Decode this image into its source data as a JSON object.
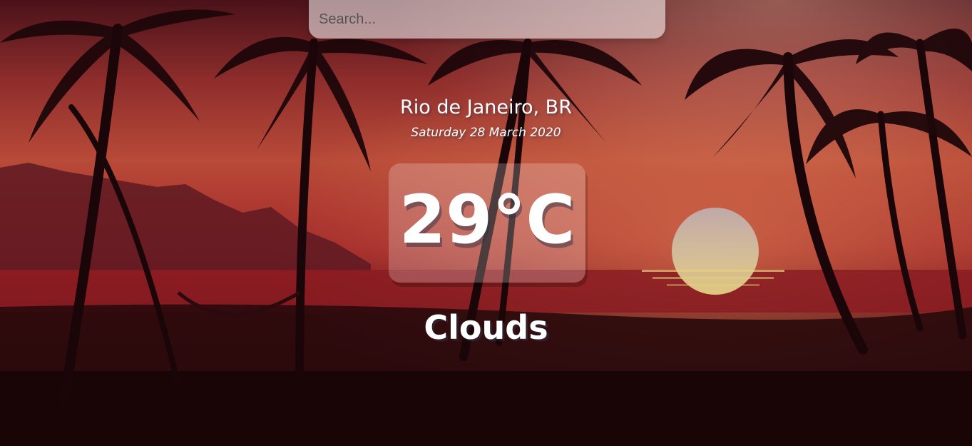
{
  "search": {
    "placeholder": "Search...",
    "value": ""
  },
  "location": "Rio de Janeiro, BR",
  "date": "Saturday 28 March 2020",
  "temperature": "29°C",
  "weather": "Clouds",
  "background": {
    "scene": "tropical sunset beach with palm trees",
    "colors": {
      "sky_top": "#5a1a22",
      "sky_glow": "#c0493a",
      "sea": "#8a1c22",
      "sun": "#d9c9a8",
      "foreground": "#1e0708"
    }
  }
}
